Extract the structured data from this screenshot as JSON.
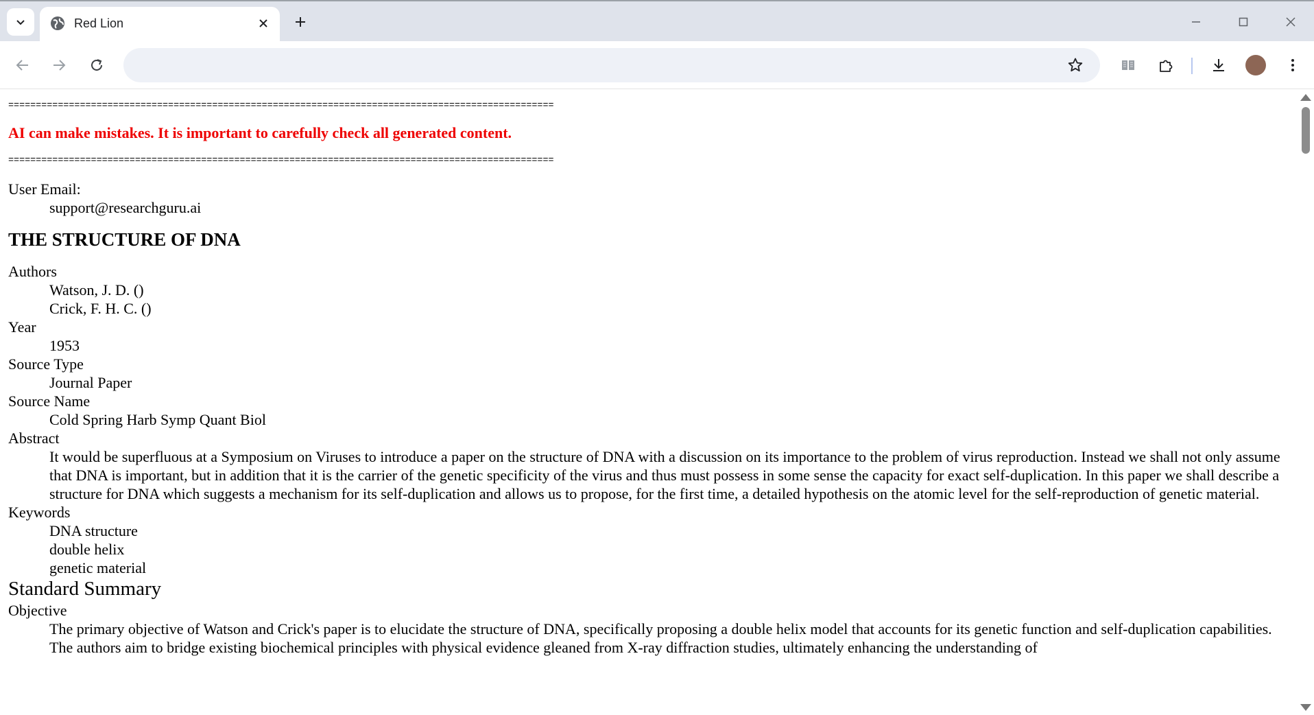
{
  "browser": {
    "tab_title": "Red Lion",
    "omnibox_value": "",
    "colors": {
      "tabbar": "#dfe3eb",
      "omnibox": "#eef1f7",
      "avatar": "#8d6655"
    }
  },
  "page": {
    "rule": "===================================================================================================",
    "warning": "AI can make mistakes. It is important to carefully check all generated content.",
    "user_email_label": "User Email:",
    "user_email": "support@researchguru.ai",
    "title": "THE STRUCTURE OF DNA",
    "authors_label": "Authors",
    "authors": [
      "Watson, J. D. ()",
      "Crick, F. H. C. ()"
    ],
    "year_label": "Year",
    "year": "1953",
    "source_type_label": "Source Type",
    "source_type": "Journal Paper",
    "source_name_label": "Source Name",
    "source_name": "Cold Spring Harb Symp Quant Biol",
    "abstract_label": "Abstract",
    "abstract": "It would be superfluous at a Symposium on Viruses to introduce a paper on the structure of DNA with a discussion on its importance to the problem of virus reproduction. Instead we shall not only assume that DNA is important, but in addition that it is the carrier of the genetic specificity of the virus and thus must possess in some sense the capacity for exact self-duplication. In this paper we shall describe a structure for DNA which suggests a mechanism for its self-duplication and allows us to propose, for the first time, a detailed hypothesis on the atomic level for the self-reproduction of genetic material.",
    "keywords_label": "Keywords",
    "keywords": [
      "DNA structure",
      "double helix",
      "genetic material"
    ],
    "summary_heading": "Standard Summary",
    "objective_label": "Objective",
    "objective": "The primary objective of Watson and Crick's paper is to elucidate the structure of DNA, specifically proposing a double helix model that accounts for its genetic function and self-duplication capabilities. The authors aim to bridge existing biochemical principles with physical evidence gleaned from X-ray diffraction studies, ultimately enhancing the understanding of",
    "warning_color": "#ee0000"
  }
}
